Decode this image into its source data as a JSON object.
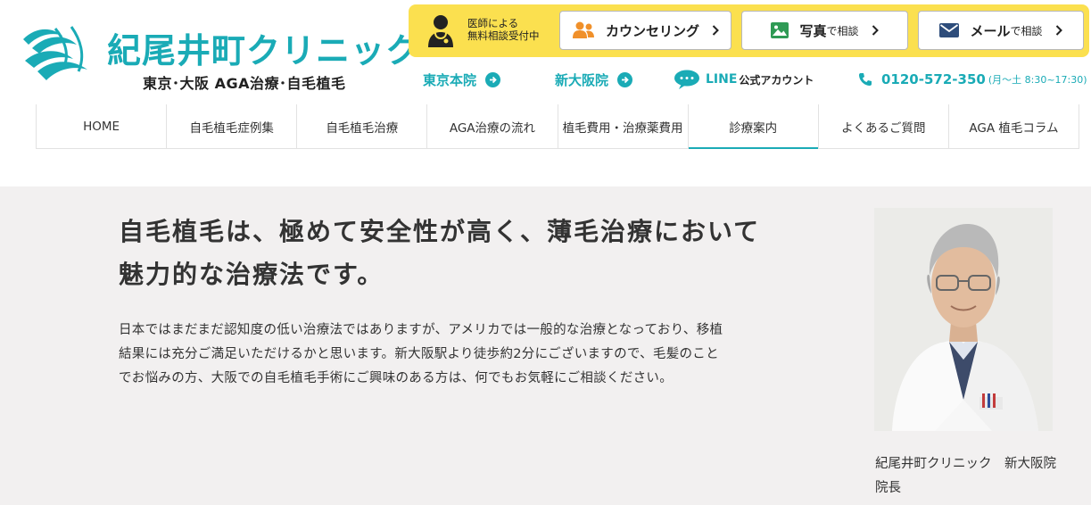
{
  "header": {
    "logo": {
      "name": "紀尾井町クリニック",
      "tagline": "東京･大阪 AGA治療･自毛植毛"
    },
    "cta": {
      "doctor_line1": "医師による",
      "doctor_line2": "無料相談受付中",
      "counseling_label": "カウンセリング",
      "photo_label": "写真",
      "photo_suffix": "で相談",
      "mail_label": "メール",
      "mail_suffix": "で相談"
    },
    "subnav": {
      "tokyo": "東京本院",
      "osaka": "新大阪院",
      "line": "LINE",
      "line_account": "公式アカウント",
      "tel": "0120-572-350",
      "hours": "(月〜土 8:30~17:30)"
    },
    "colors": {
      "accent": "#1aabb6",
      "cta_bg": "#fbe04f",
      "section_bg": "#f2f0f0"
    }
  },
  "nav": {
    "items": [
      {
        "label": "HOME"
      },
      {
        "label": "自毛植毛症例集"
      },
      {
        "label": "自毛植毛治療"
      },
      {
        "label": "AGA治療の流れ"
      },
      {
        "label": "植毛費用・治療薬費用"
      },
      {
        "label": "診療案内",
        "active": true
      },
      {
        "label": "よくあるご質問"
      },
      {
        "label": "AGA 植毛コラム"
      }
    ]
  },
  "intro": {
    "lead_line1": "自毛植毛は、極めて安全性が高く、薄毛治療において",
    "lead_line2": "魅力的な治療法です。",
    "body_line1": "日本ではまだまだ認知度の低い治療法ではありますが、アメリカでは一般的な治療となっており、移植",
    "body_line2": "結果には充分ご満足いただけるかと思います。新大阪駅より徒歩約2分にございますので、毛髪のこと",
    "body_line3": "でお悩みの方、大阪での自毛植毛手術にご興味のある方は、何でもお気軽にご相談ください。",
    "caption_line1": "紀尾井町クリニック　新大阪院",
    "caption_line2": "院長"
  }
}
